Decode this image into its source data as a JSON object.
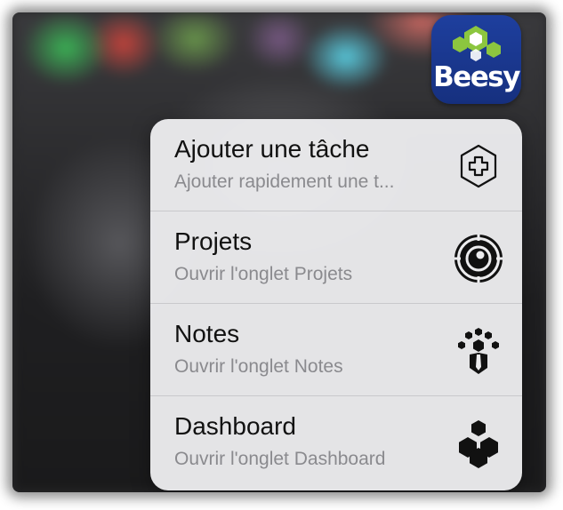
{
  "app": {
    "name": "Beesy",
    "icon": "beesy-hexagon-logo",
    "colors": {
      "background": "#1c3a94",
      "green": "#8cc63f",
      "white": "#ffffff"
    }
  },
  "menu": {
    "items": [
      {
        "title": "Ajouter une tâche",
        "subtitle": "Ajouter rapidement une t...",
        "icon": "add-hexagon-icon"
      },
      {
        "title": "Projets",
        "subtitle": "Ouvrir l'onglet Projets",
        "icon": "target-icon"
      },
      {
        "title": "Notes",
        "subtitle": "Ouvrir l'onglet Notes",
        "icon": "meeting-notes-icon"
      },
      {
        "title": "Dashboard",
        "subtitle": "Ouvrir l'onglet Dashboard",
        "icon": "hexagons-dashboard-icon"
      }
    ]
  }
}
